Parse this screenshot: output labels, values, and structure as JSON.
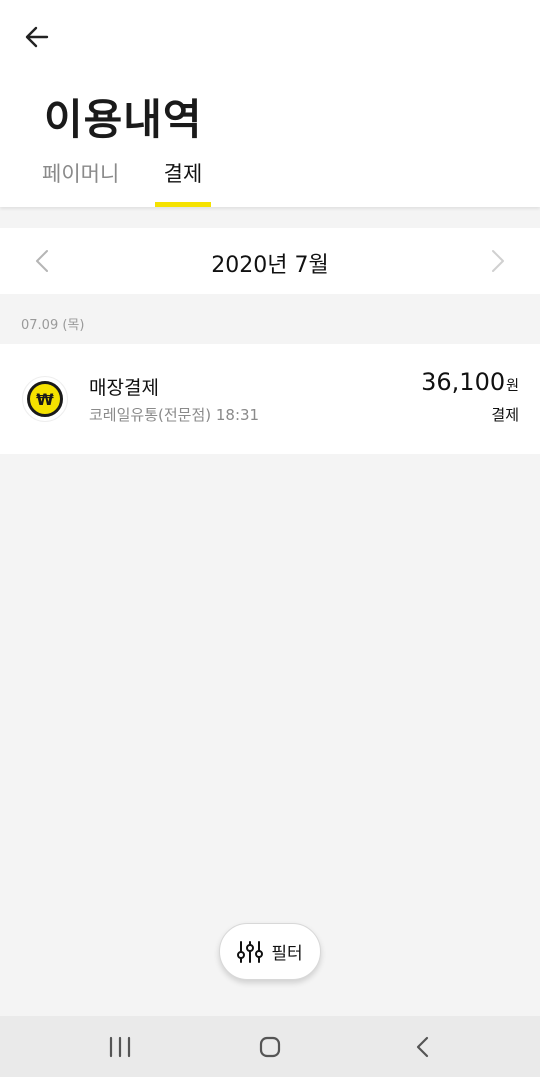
{
  "header": {
    "title": "이용내역",
    "tabs": [
      {
        "label": "페이머니",
        "active": false
      },
      {
        "label": "결제",
        "active": true
      }
    ],
    "accent_color": "#f5e200"
  },
  "month_selector": {
    "label": "2020년 7월"
  },
  "sections": [
    {
      "date": "07.09 (목)",
      "transactions": [
        {
          "icon": "won-coin-icon",
          "title": "매장결제",
          "subtitle": "코레일유통(전문점) 18:31",
          "amount": "36,100",
          "unit": "원",
          "type": "결제"
        }
      ]
    }
  ],
  "filter": {
    "label": "필터",
    "icon": "sliders-icon"
  },
  "icon_text": {
    "won_symbol": "₩"
  },
  "system_nav": {
    "icons": [
      "recent-apps-icon",
      "home-icon",
      "back-icon"
    ]
  }
}
